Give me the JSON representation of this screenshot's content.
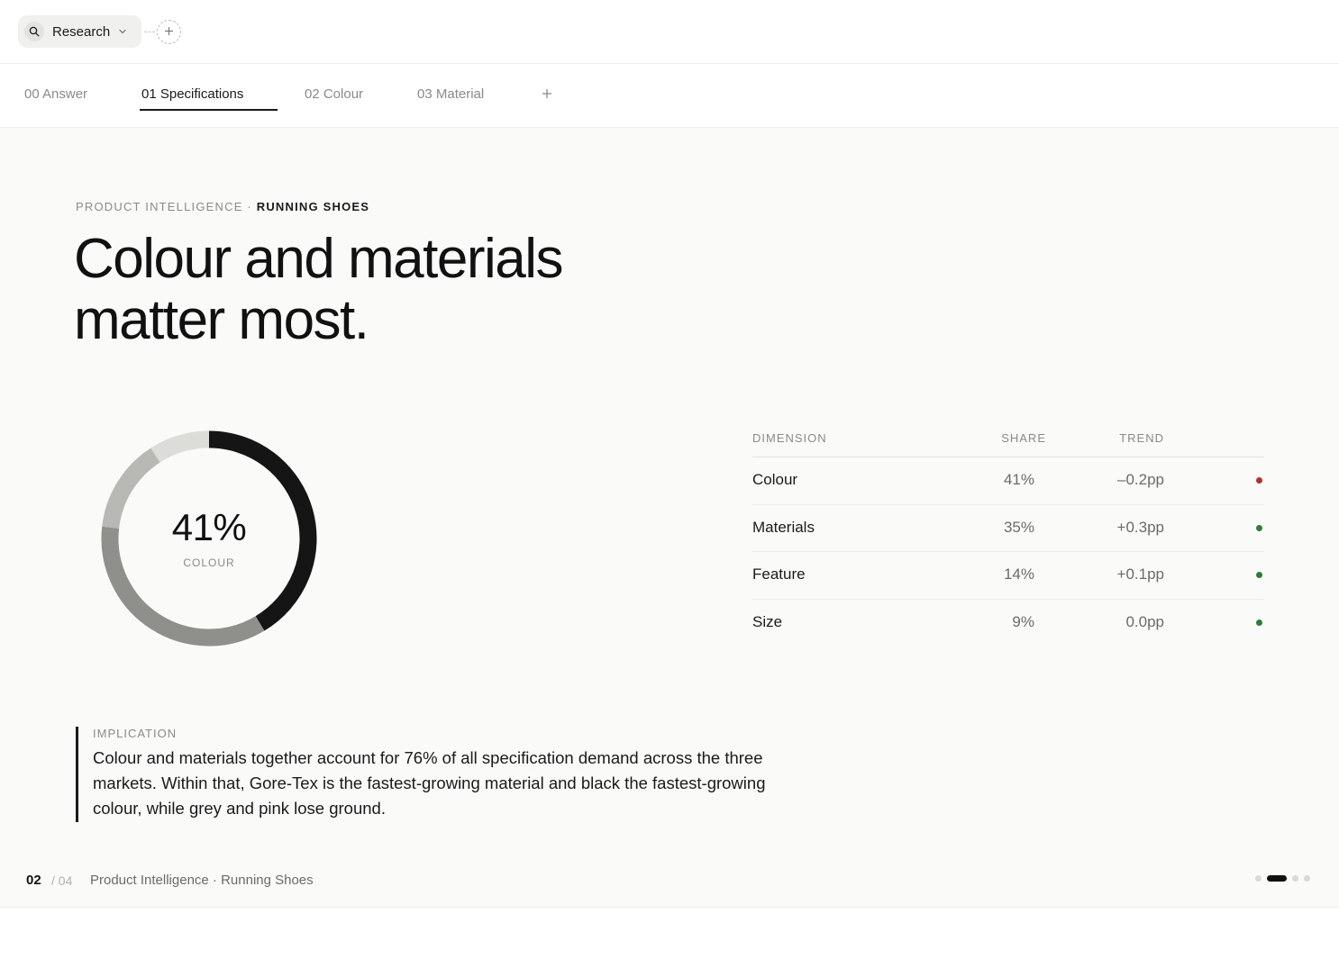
{
  "topbar": {
    "workspace_label": "Research",
    "icons": {
      "search": "search-icon",
      "dropdown": "chevron-down-icon",
      "add": "plus-icon"
    }
  },
  "tabs": [
    {
      "label": "00 Answer",
      "active": false
    },
    {
      "label": "01 Specifications",
      "active": true
    },
    {
      "label": "02 Colour",
      "active": false
    },
    {
      "label": "03 Material",
      "active": false
    }
  ],
  "tab_add_icon": "plus-icon",
  "main": {
    "eyebrow_prefix": "PRODUCT INTELLIGENCE · ",
    "eyebrow_strong": "RUNNING SHOES",
    "headline_line1": "Colour and materials",
    "headline_line2": "matter most."
  },
  "donut": {
    "value_text": "41%",
    "caption": "COLOUR",
    "segments": [
      {
        "name": "Colour",
        "share": 41,
        "color": "#151515"
      },
      {
        "name": "Materials",
        "share": 35,
        "color": "#8f8f8c"
      },
      {
        "name": "Feature",
        "share": 14,
        "color": "#b8b8b5"
      },
      {
        "name": "Size",
        "share": 9,
        "color": "#dcdcd9"
      }
    ]
  },
  "table": {
    "headers": {
      "dimension": "DIMENSION",
      "share": "SHARE",
      "trend": "TREND"
    },
    "rows": [
      {
        "name": "Colour",
        "share": "41%",
        "trend": "–0.2pp",
        "status": "down",
        "dot_color": "#b3322c"
      },
      {
        "name": "Materials",
        "share": "35%",
        "trend": "+0.3pp",
        "status": "up",
        "dot_color": "#2e7d3a"
      },
      {
        "name": "Feature",
        "share": "14%",
        "trend": "+0.1pp",
        "status": "up",
        "dot_color": "#2e7d3a"
      },
      {
        "name": "Size",
        "share": "9%",
        "trend": "0.0pp",
        "status": "up",
        "dot_color": "#2e7d3a"
      }
    ]
  },
  "implication": {
    "label": "IMPLICATION",
    "text": "Colour and materials together account for 76% of all specification demand across the three markets. Within that, Gore-Tex is the fastest-growing material and black the fastest-growing colour, while grey and pink lose ground."
  },
  "footer": {
    "page": "02",
    "total": "/ 04",
    "title": "Product Intelligence · Running Shoes",
    "pager_count": 4,
    "pager_active": 1
  },
  "colors": {
    "accent": "#111111",
    "background": "#fafaf8",
    "muted": "#8a8a88"
  }
}
